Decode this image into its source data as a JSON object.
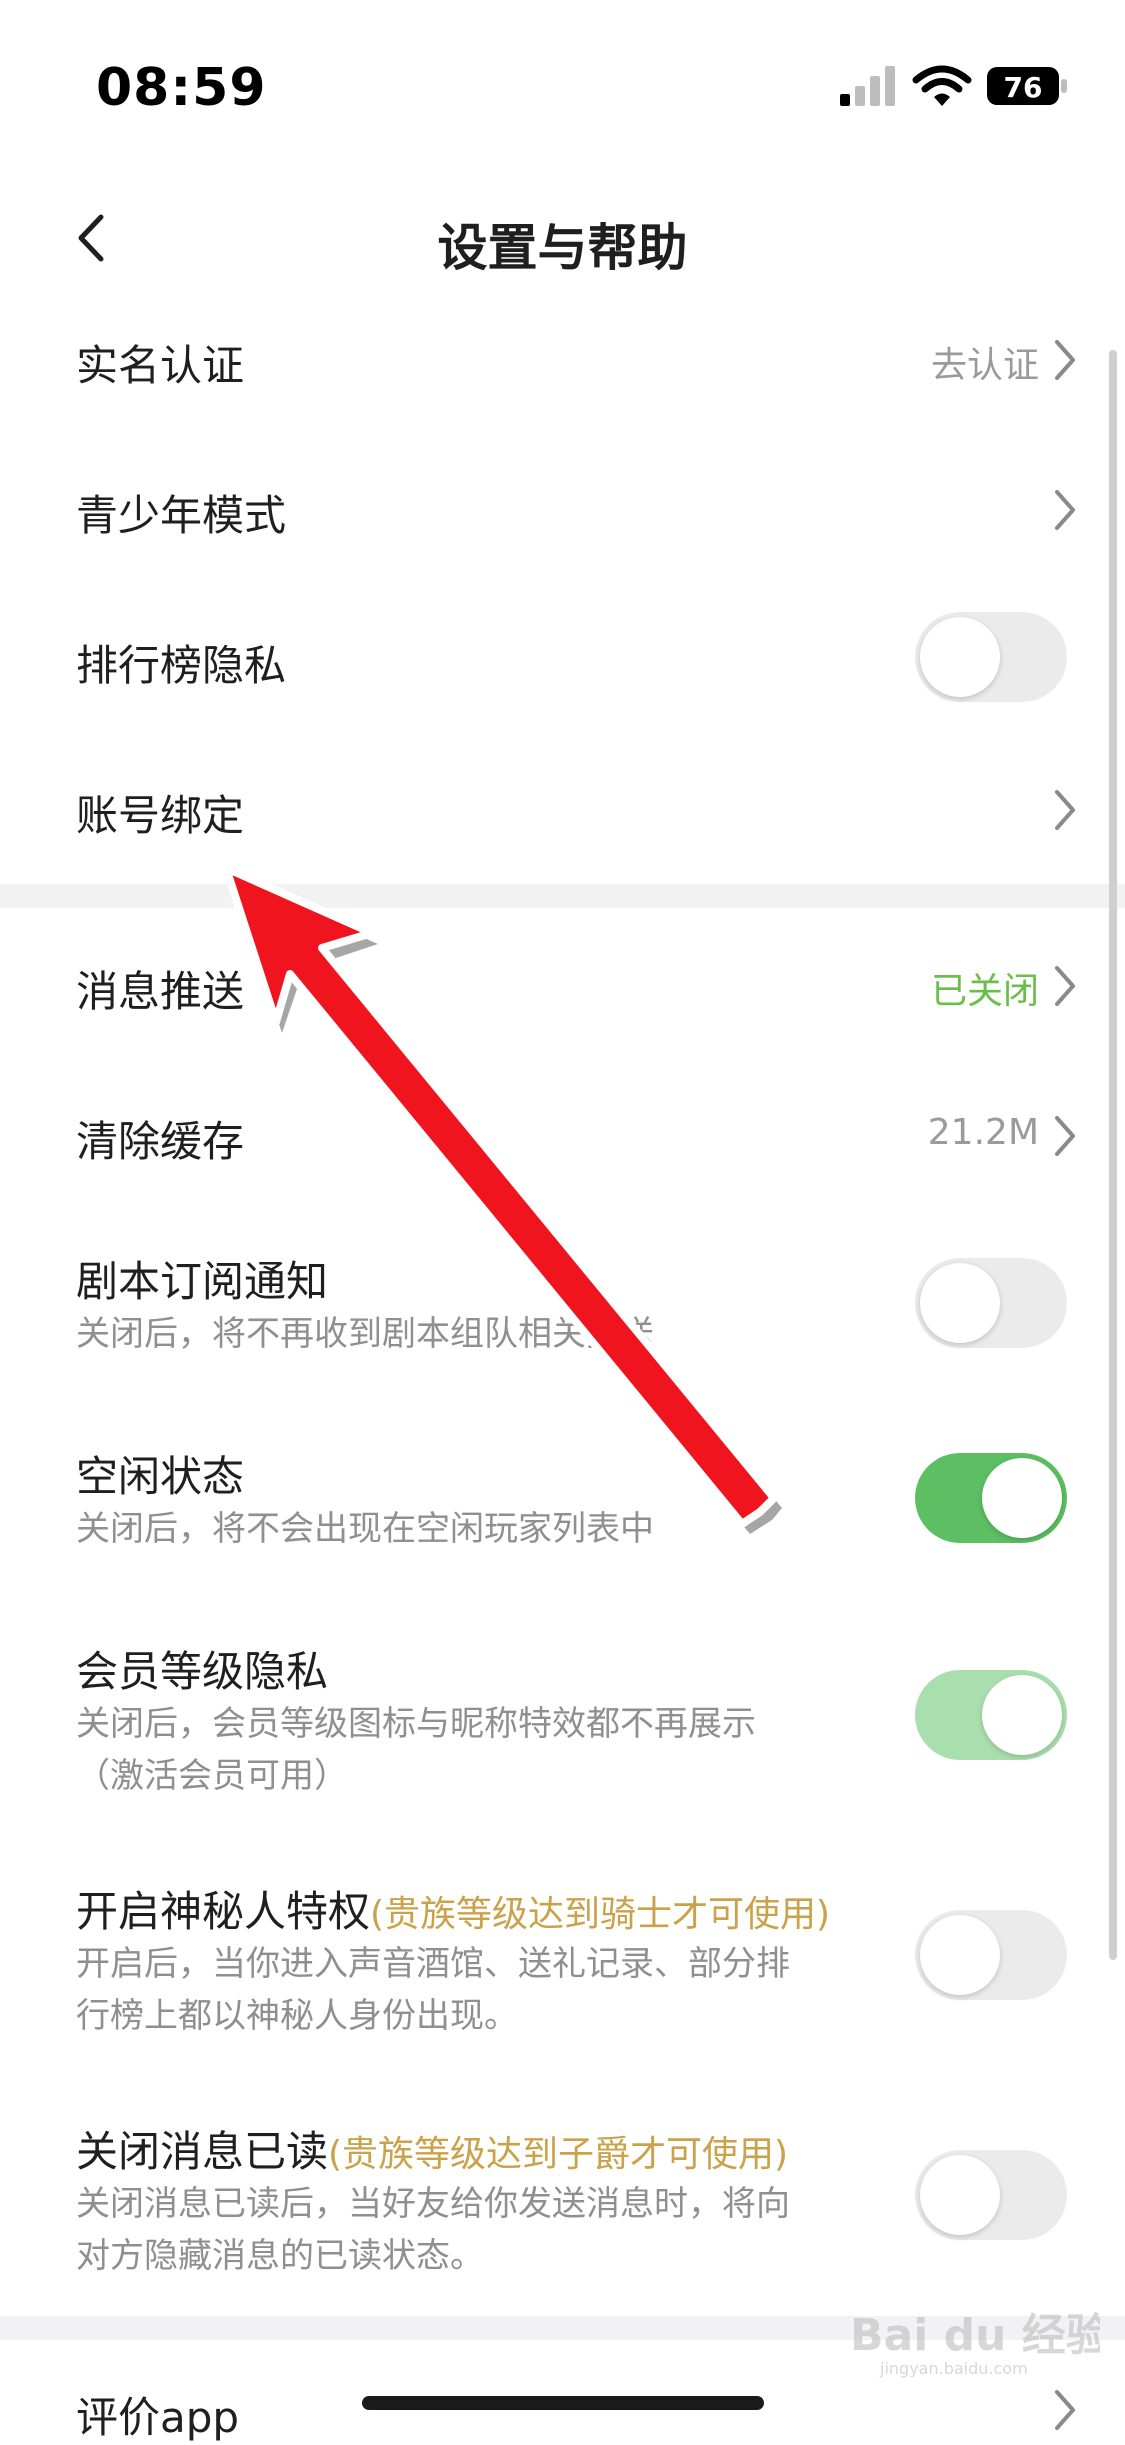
{
  "status": {
    "time": "08:59",
    "battery": "76"
  },
  "nav": {
    "title": "设置与帮助"
  },
  "rows": [
    {
      "label": "实名认证",
      "value": "去认证"
    },
    {
      "label": "青少年模式"
    },
    {
      "label": "排行榜隐私",
      "toggle": "off"
    },
    {
      "label": "账号绑定"
    },
    {
      "label": "消息推送",
      "value": "已关闭"
    },
    {
      "label": "清除缓存",
      "value": "21.2M"
    },
    {
      "label": "剧本订阅通知",
      "sub": "关闭后，将不再收到剧本组队相关推送",
      "toggle": "off"
    },
    {
      "label": "空闲状态",
      "sub": "关闭后，将不会出现在空闲玩家列表中",
      "toggle": "on"
    },
    {
      "label": "会员等级隐私",
      "sub": "关闭后，会员等级图标与昵称特效都不再展示",
      "sub2": "（激活会员可用）",
      "toggle": "on-disabled"
    },
    {
      "label": "开启神秘人特权",
      "note": "(贵族等级达到骑士才可使用)",
      "sub": "开启后，当你进入声音酒馆、送礼记录、部分排",
      "sub2": "行榜上都以神秘人身份出现。",
      "toggle": "off"
    },
    {
      "label": "关闭消息已读",
      "note": "(贵族等级达到子爵才可使用)",
      "sub": "关闭消息已读后，当好友给你发送消息时，将向",
      "sub2": "对方隐藏消息的已读状态。",
      "toggle": "off"
    },
    {
      "label": "评价app"
    }
  ],
  "watermark": {
    "text": "Bai du 经验",
    "url": "jingyan.baidu.com"
  },
  "colors": {
    "toggle_on": "#5cbf63",
    "toggle_off": "#ebebeb",
    "status_off": "#6abf4b",
    "premium_note": "#c9a24a",
    "arrow": "#f0141e"
  }
}
